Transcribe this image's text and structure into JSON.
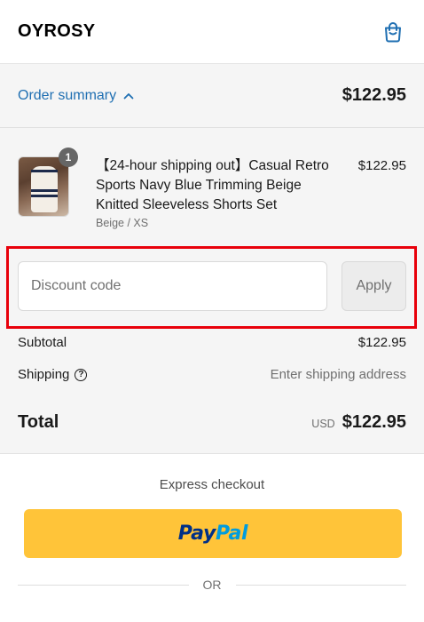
{
  "header": {
    "brand": "OYROSY",
    "cart_icon": "shopping-bag-icon"
  },
  "summary": {
    "toggle_label": "Order summary",
    "toggle_icon": "chevron-up-icon",
    "total": "$122.95"
  },
  "product": {
    "quantity": "1",
    "title": "【24-hour shipping out】Casual Retro Sports Navy Blue Trimming Beige Knitted Sleeveless Shorts Set",
    "variant": "Beige / XS",
    "price": "$122.95"
  },
  "discount": {
    "placeholder": "Discount code",
    "apply_label": "Apply",
    "highlight_color": "#e8000b"
  },
  "subtotal": {
    "label": "Subtotal",
    "value": "$122.95"
  },
  "shipping": {
    "label": "Shipping",
    "info_icon": "question-circle-icon",
    "value": "Enter shipping address"
  },
  "total": {
    "label": "Total",
    "currency": "USD",
    "value": "$122.95"
  },
  "express": {
    "label": "Express checkout",
    "paypal_pay": "Pay",
    "paypal_pal": "Pal",
    "button_color": "#ffc439",
    "or_label": "OR"
  },
  "colors": {
    "link": "#1f6fb2",
    "panel_bg": "#f5f5f5"
  }
}
